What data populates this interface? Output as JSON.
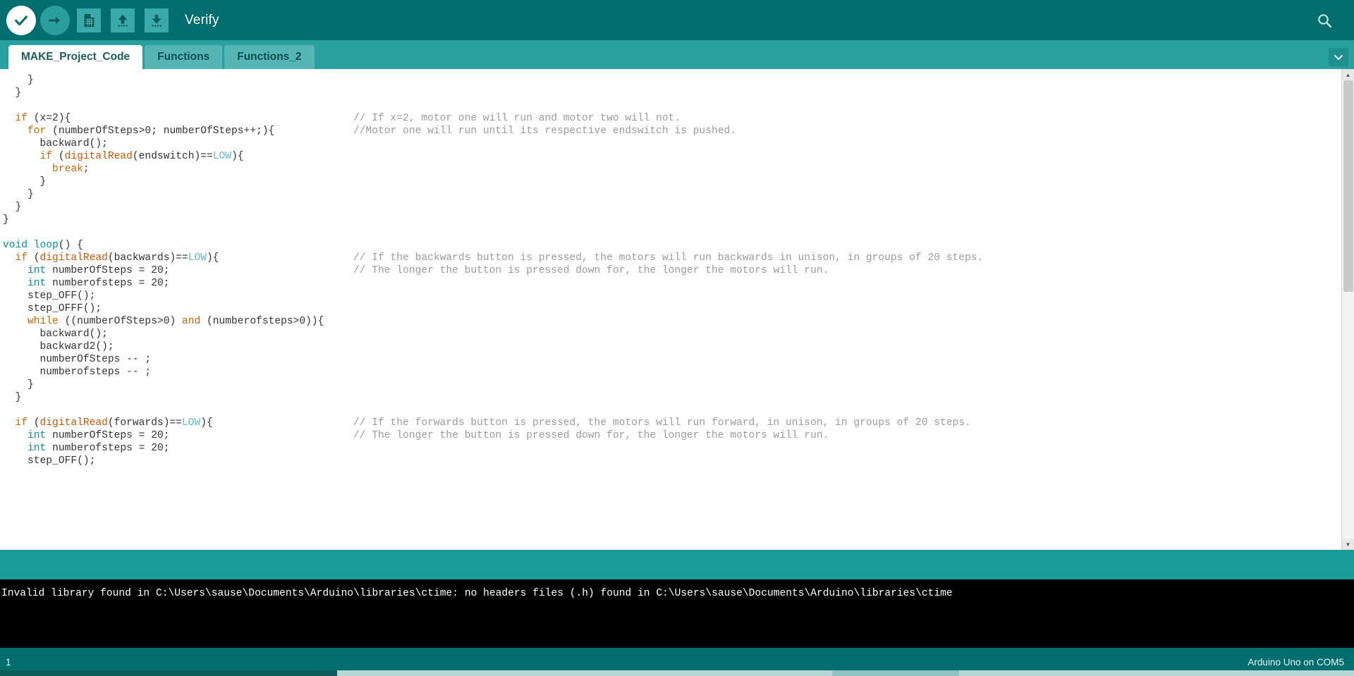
{
  "toolbar": {
    "buttons": [
      {
        "name": "verify-button",
        "icon": "check-icon",
        "title": "Verify"
      },
      {
        "name": "upload-button",
        "icon": "arrow-right-icon",
        "title": "Upload"
      },
      {
        "name": "new-sketch-button",
        "icon": "new-file-icon",
        "title": "New"
      },
      {
        "name": "open-sketch-button",
        "icon": "arrow-up-icon",
        "title": "Open"
      },
      {
        "name": "save-sketch-button",
        "icon": "arrow-down-icon",
        "title": "Save"
      }
    ],
    "title": "Verify",
    "search_icon": "search-icon"
  },
  "tabs": {
    "items": [
      {
        "label": "MAKE_Project_Code",
        "active": true
      },
      {
        "label": "Functions",
        "active": false
      },
      {
        "label": "Functions_2",
        "active": false
      }
    ],
    "menu_icon": "chevron-down-icon"
  },
  "editor": {
    "lines": [
      {
        "indent": 4,
        "code": [
          {
            "t": "}",
            "c": "pl"
          }
        ]
      },
      {
        "indent": 2,
        "code": [
          {
            "t": "}",
            "c": "pl"
          }
        ]
      },
      {
        "indent": 0,
        "code": []
      },
      {
        "indent": 2,
        "code": [
          {
            "t": "if",
            "c": "kw"
          },
          {
            "t": " (x=2){",
            "c": "pl"
          }
        ],
        "comment": "// If x=2, motor one will run and motor two will not."
      },
      {
        "indent": 4,
        "code": [
          {
            "t": "for",
            "c": "kw"
          },
          {
            "t": " (numberOfSteps>0; numberOfSteps++;){",
            "c": "pl"
          }
        ],
        "comment": "//Motor one will run until its respective endswitch is pushed."
      },
      {
        "indent": 6,
        "code": [
          {
            "t": "backward();",
            "c": "pl"
          }
        ]
      },
      {
        "indent": 6,
        "code": [
          {
            "t": "if",
            "c": "kw"
          },
          {
            "t": " (",
            "c": "pl"
          },
          {
            "t": "digitalRead",
            "c": "fn"
          },
          {
            "t": "(endswitch)==",
            "c": "pl"
          },
          {
            "t": "LOW",
            "c": "lit"
          },
          {
            "t": "){",
            "c": "pl"
          }
        ]
      },
      {
        "indent": 8,
        "code": [
          {
            "t": "break",
            "c": "kw"
          },
          {
            "t": ";",
            "c": "pl"
          }
        ]
      },
      {
        "indent": 6,
        "code": [
          {
            "t": "}",
            "c": "pl"
          }
        ]
      },
      {
        "indent": 4,
        "code": [
          {
            "t": "}",
            "c": "pl"
          }
        ]
      },
      {
        "indent": 2,
        "code": [
          {
            "t": "}",
            "c": "pl"
          }
        ]
      },
      {
        "indent": 0,
        "code": [
          {
            "t": "}",
            "c": "pl"
          }
        ]
      },
      {
        "indent": 0,
        "code": []
      },
      {
        "indent": 0,
        "code": [
          {
            "t": "void",
            "c": "typ"
          },
          {
            "t": " ",
            "c": "pl"
          },
          {
            "t": "loop",
            "c": "fn2"
          },
          {
            "t": "() {",
            "c": "pl"
          }
        ]
      },
      {
        "indent": 2,
        "code": [
          {
            "t": "if",
            "c": "kw"
          },
          {
            "t": " (",
            "c": "pl"
          },
          {
            "t": "digitalRead",
            "c": "fn"
          },
          {
            "t": "(backwards)==",
            "c": "pl"
          },
          {
            "t": "LOW",
            "c": "lit"
          },
          {
            "t": "){",
            "c": "pl"
          }
        ],
        "comment": "// If the backwards button is pressed, the motors will run backwards in unison, in groups of 20 steps."
      },
      {
        "indent": 4,
        "code": [
          {
            "t": "int",
            "c": "typ"
          },
          {
            "t": " numberOfSteps = 20;",
            "c": "pl"
          }
        ],
        "comment": "// The longer the button is pressed down for, the longer the motors will run."
      },
      {
        "indent": 4,
        "code": [
          {
            "t": "int",
            "c": "typ"
          },
          {
            "t": " numberofsteps = 20;",
            "c": "pl"
          }
        ]
      },
      {
        "indent": 4,
        "code": [
          {
            "t": "step_OFF();",
            "c": "pl"
          }
        ]
      },
      {
        "indent": 4,
        "code": [
          {
            "t": "step_OFFF();",
            "c": "pl"
          }
        ]
      },
      {
        "indent": 4,
        "code": [
          {
            "t": "while",
            "c": "kw"
          },
          {
            "t": " ((numberOfSteps>0) ",
            "c": "pl"
          },
          {
            "t": "and",
            "c": "kw"
          },
          {
            "t": " (numberofsteps>0)){",
            "c": "pl"
          }
        ]
      },
      {
        "indent": 6,
        "code": [
          {
            "t": "backward();",
            "c": "pl"
          }
        ]
      },
      {
        "indent": 6,
        "code": [
          {
            "t": "backward2();",
            "c": "pl"
          }
        ]
      },
      {
        "indent": 6,
        "code": [
          {
            "t": "numberOfSteps -- ;",
            "c": "pl"
          }
        ]
      },
      {
        "indent": 6,
        "code": [
          {
            "t": "numberofsteps -- ;",
            "c": "pl"
          }
        ]
      },
      {
        "indent": 4,
        "code": [
          {
            "t": "}",
            "c": "pl"
          }
        ]
      },
      {
        "indent": 2,
        "code": [
          {
            "t": "}",
            "c": "pl"
          }
        ]
      },
      {
        "indent": 0,
        "code": []
      },
      {
        "indent": 2,
        "code": [
          {
            "t": "if",
            "c": "kw"
          },
          {
            "t": " (",
            "c": "pl"
          },
          {
            "t": "digitalRead",
            "c": "fn"
          },
          {
            "t": "(forwards)==",
            "c": "pl"
          },
          {
            "t": "LOW",
            "c": "lit"
          },
          {
            "t": "){",
            "c": "pl"
          }
        ],
        "comment": "// If the forwards button is pressed, the motors will run forward, in unison, in groups of 20 steps."
      },
      {
        "indent": 4,
        "code": [
          {
            "t": "int",
            "c": "typ"
          },
          {
            "t": " numberOfSteps = 20;",
            "c": "pl"
          }
        ],
        "comment": "// The longer the button is pressed down for, the longer the motors will run."
      },
      {
        "indent": 4,
        "code": [
          {
            "t": "int",
            "c": "typ"
          },
          {
            "t": " numberofsteps = 20;",
            "c": "pl"
          }
        ]
      },
      {
        "indent": 4,
        "code": [
          {
            "t": "step_OFF();",
            "c": "pl"
          }
        ]
      }
    ]
  },
  "console": {
    "message": "Invalid library found in C:\\Users\\sause\\Documents\\Arduino\\libraries\\ctime: no headers files (.h) found in C:\\Users\\sause\\Documents\\Arduino\\libraries\\ctime"
  },
  "status": {
    "line_number": "1",
    "board": "Arduino Uno on COM5"
  },
  "colors": {
    "toolbar_bg": "#006e6e",
    "tabbar_bg": "#29a0a0",
    "accent": "#00979c",
    "console_bg": "#000000",
    "keyword": "#cc6600",
    "type": "#00979c",
    "comment": "#9b9b9b",
    "literal": "#64b5cd"
  }
}
